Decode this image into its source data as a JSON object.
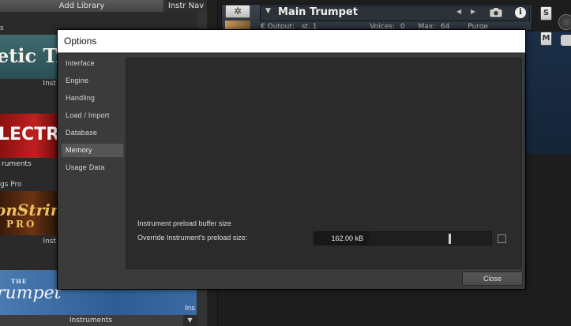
{
  "library": {
    "add_library_label": "Add Library",
    "instr_nav_label": "Instr Nav",
    "entries": [
      {
        "top_label": "s",
        "banner_text": "etic Tr",
        "foot_label": "Inst"
      },
      {
        "banner_text": "LECTRI",
        "foot_label": "ruments"
      },
      {
        "top_label": "gs Pro",
        "banner_text": "onString",
        "banner_sub": "PRO",
        "foot_label": "Inst"
      },
      {
        "banner_small": "THE",
        "banner_text": "rumpet",
        "foot_label": "Ins"
      }
    ],
    "bottom_label": "Instruments",
    "bottom_arrow": "▼"
  },
  "instrument": {
    "title": "Main Trumpet",
    "gear_glyph": "✲",
    "output_label": "Output:",
    "output_value": "st. 1",
    "voices_label": "Voices:",
    "voices_value": "0",
    "max_label": "Max:",
    "max_value": "64",
    "purge_label": "Purge",
    "solo_label": "S",
    "mute_label": "M",
    "info_glyph": "i",
    "nav_prev": "◀",
    "nav_next": "▶",
    "dropdown_arrow": "▼"
  },
  "dialog": {
    "title": "Options",
    "nav_items": [
      {
        "label": "Interface"
      },
      {
        "label": "Engine"
      },
      {
        "label": "Handling"
      },
      {
        "label": "Load / Import"
      },
      {
        "label": "Database"
      },
      {
        "label": "Memory"
      },
      {
        "label": "Usage Data"
      }
    ],
    "active_nav": "Memory",
    "memory": {
      "section_label": "Instrument preload buffer size",
      "override_label": "Override Instrument's preload size:",
      "preload_value": "162.00 kB",
      "slider_fraction": 0.65,
      "override_checked": false
    },
    "close_label": "Close"
  },
  "colors": {
    "dialog_bg": "#3b3b3b",
    "content_bg": "#2b2b2b",
    "active_nav_bg": "#555555",
    "rack_blue": "#1b2e47"
  }
}
